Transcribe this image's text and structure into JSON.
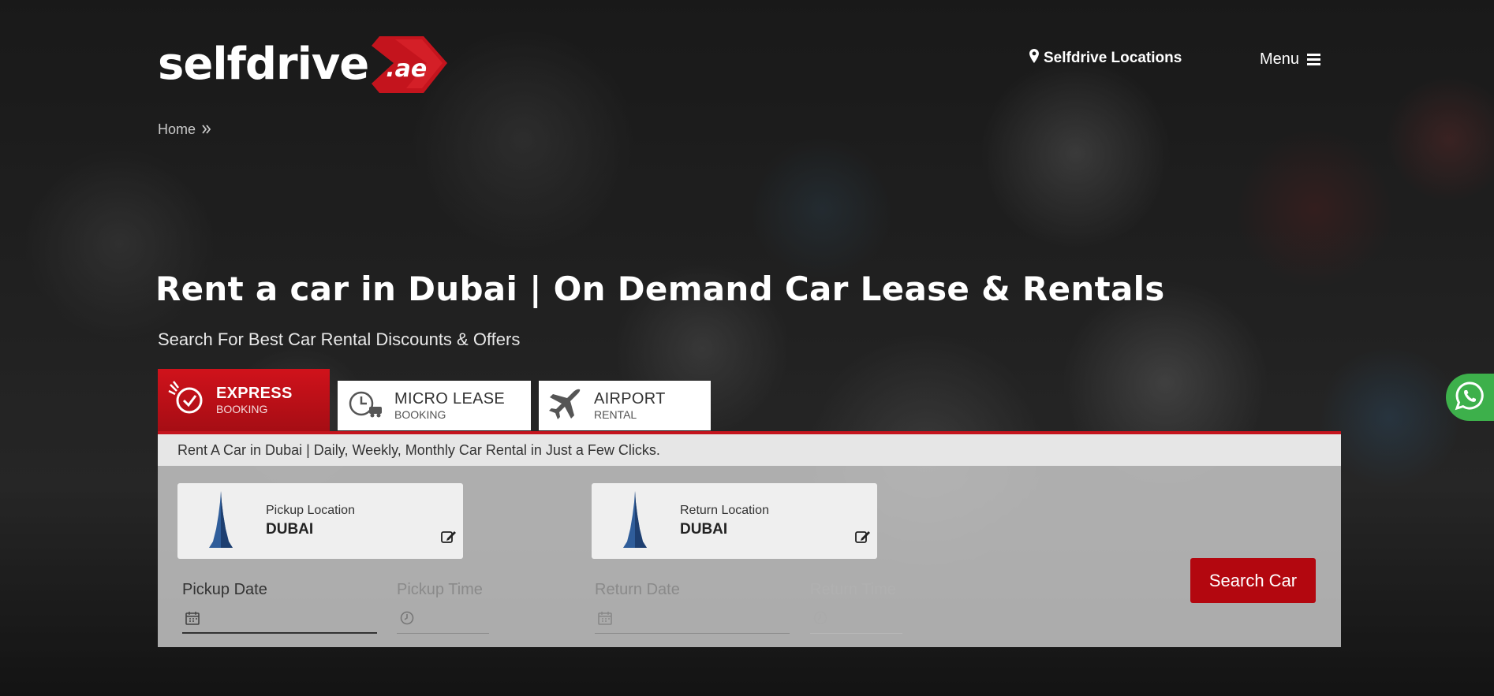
{
  "brand": {
    "logo_text": "selfdrive",
    "logo_suffix": ".ae",
    "accent": "#c4141d"
  },
  "header": {
    "locations_label": "Selfdrive Locations",
    "menu_label": "Menu"
  },
  "breadcrumb": {
    "home": "Home"
  },
  "hero": {
    "title": "Rent a car in Dubai | On Demand Car Lease & Rentals",
    "subtitle": "Search For Best Car Rental Discounts & Offers"
  },
  "tabs": [
    {
      "title": "EXPRESS",
      "sub": "BOOKING",
      "active": true
    },
    {
      "title": "MICRO LEASE",
      "sub": "BOOKING",
      "active": false
    },
    {
      "title": "AIRPORT",
      "sub": "RENTAL",
      "active": false
    }
  ],
  "panel": {
    "banner": "Rent A Car in Dubai | Daily, Weekly, Monthly Car Rental in Just a Few Clicks.",
    "pickup": {
      "label": "Pickup Location",
      "value": "DUBAI"
    },
    "return": {
      "label": "Return Location",
      "value": "DUBAI"
    },
    "fields": {
      "pickup_date": "Pickup Date",
      "pickup_time": "Pickup Time",
      "return_date": "Return Date",
      "return_time": "Return Time"
    },
    "search_button": "Search Car"
  },
  "icons": [
    "map-marker-icon",
    "menu-icon",
    "chevron-double-right-icon",
    "express-clock-icon",
    "micro-lease-icon",
    "airplane-icon",
    "burj-khalifa-icon",
    "edit-icon",
    "calendar-icon",
    "clock-icon",
    "whatsapp-icon"
  ]
}
